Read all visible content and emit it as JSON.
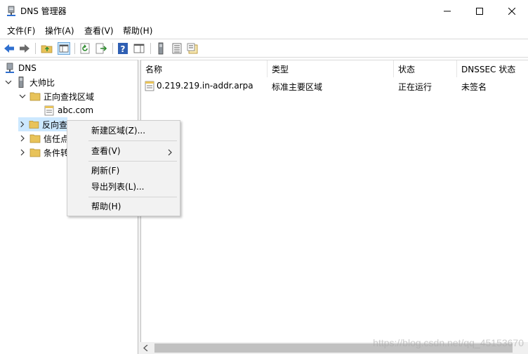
{
  "window": {
    "title": "DNS 管理器"
  },
  "menu": {
    "file": "文件(F)",
    "action": "操作(A)",
    "view": "查看(V)",
    "help": "帮助(H)"
  },
  "toolbar": {
    "icons": [
      "back-arrow-icon",
      "forward-arrow-icon",
      "up-folder-icon",
      "show-hide-console-tree-icon",
      "refresh-icon",
      "export-list-icon",
      "help-icon",
      "show-hide-action-pane-icon",
      "server-icon",
      "list-icon",
      "zone-icon"
    ]
  },
  "tree": {
    "root": "DNS",
    "server": "大帅比",
    "forward_zone": "正向查找区域",
    "abc_zone": "abc.com",
    "reverse_zone": "反向查",
    "trust_points": "信任点",
    "conditional": "条件转"
  },
  "list": {
    "columns": [
      "名称",
      "类型",
      "状态",
      "DNSSEC 状态"
    ],
    "rows": [
      {
        "name": "0.219.219.in-addr.arpa",
        "type": "标准主要区域",
        "status": "正在运行",
        "dnssec": "未签名"
      }
    ]
  },
  "context_menu": {
    "new_zone": "新建区域(Z)...",
    "view": "查看(V)",
    "refresh": "刷新(F)",
    "export": "导出列表(L)...",
    "help": "帮助(H)"
  },
  "watermark": "https://blog.csdn.net/qq_45153670",
  "colors": {
    "folder": "#e8c35a",
    "selection": "#cce8ff",
    "back_arrow": "#2f6fcf"
  }
}
